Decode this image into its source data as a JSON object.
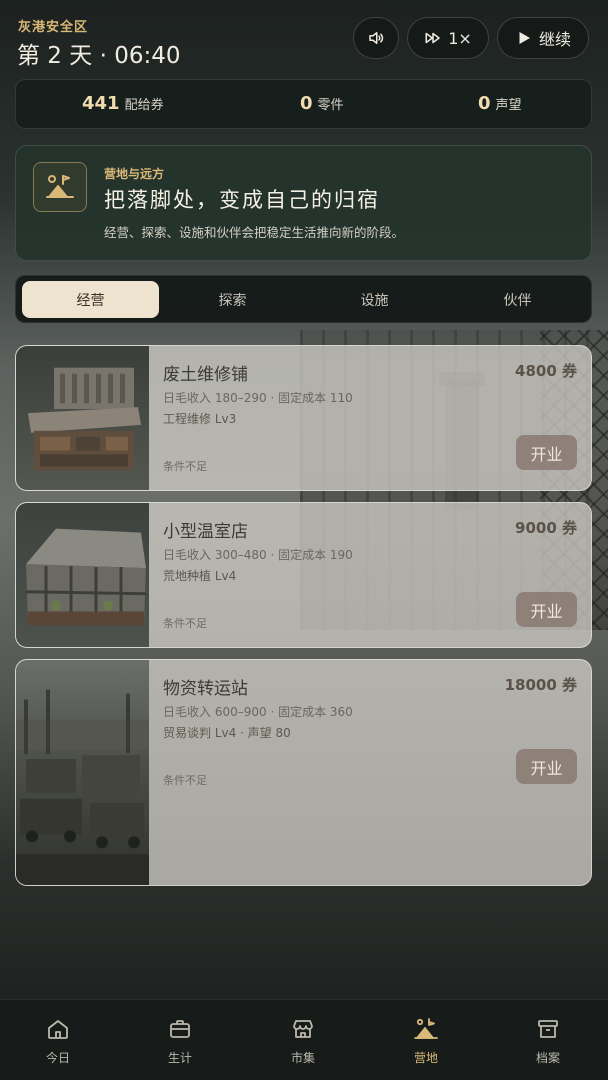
{
  "header": {
    "zone": "灰港安全区",
    "day_time": "第 2 天 · 06:40",
    "speed_label": "1×",
    "continue_label": "继续"
  },
  "resources": [
    {
      "value": "441",
      "label": "配给券"
    },
    {
      "value": "0",
      "label": "零件"
    },
    {
      "value": "0",
      "label": "声望"
    }
  ],
  "banner": {
    "kicker": "营地与远方",
    "title": "把落脚处，变成自己的归宿",
    "description": "经营、探索、设施和伙伴会把稳定生活推向新的阶段。",
    "icon": "camp-icon"
  },
  "tabs": [
    {
      "label": "经营",
      "active": true
    },
    {
      "label": "探索",
      "active": false
    },
    {
      "label": "设施",
      "active": false
    },
    {
      "label": "伙伴",
      "active": false
    }
  ],
  "businesses": [
    {
      "name": "废土维修铺",
      "price": "4800 券",
      "stats": "日毛收入 180–290 · 固定成本 110",
      "requirement": "工程维修 Lv3",
      "condition": "条件不足",
      "action": "开业",
      "image": "workbench"
    },
    {
      "name": "小型温室店",
      "price": "9000 券",
      "stats": "日毛收入 300–480 · 固定成本 190",
      "requirement": "荒地种植 Lv4",
      "condition": "条件不足",
      "action": "开业",
      "image": "greenhouse"
    },
    {
      "name": "物资转运站",
      "price": "18000 券",
      "stats": "日毛收入 600–900 · 固定成本 360",
      "requirement": "贸易谈判 Lv4 · 声望 80",
      "condition": "条件不足",
      "action": "开业",
      "image": "transit-yard"
    }
  ],
  "nav": [
    {
      "label": "今日",
      "icon": "home-icon",
      "active": false
    },
    {
      "label": "生计",
      "icon": "briefcase-icon",
      "active": false
    },
    {
      "label": "市集",
      "icon": "store-icon",
      "active": false
    },
    {
      "label": "营地",
      "icon": "camp-icon",
      "active": true
    },
    {
      "label": "档案",
      "icon": "archive-icon",
      "active": false
    }
  ],
  "colors": {
    "accent": "#d9b878",
    "tab_active_bg": "#ede3cf",
    "card_bg": "#cdcbc4",
    "button_bg": "#827066"
  }
}
